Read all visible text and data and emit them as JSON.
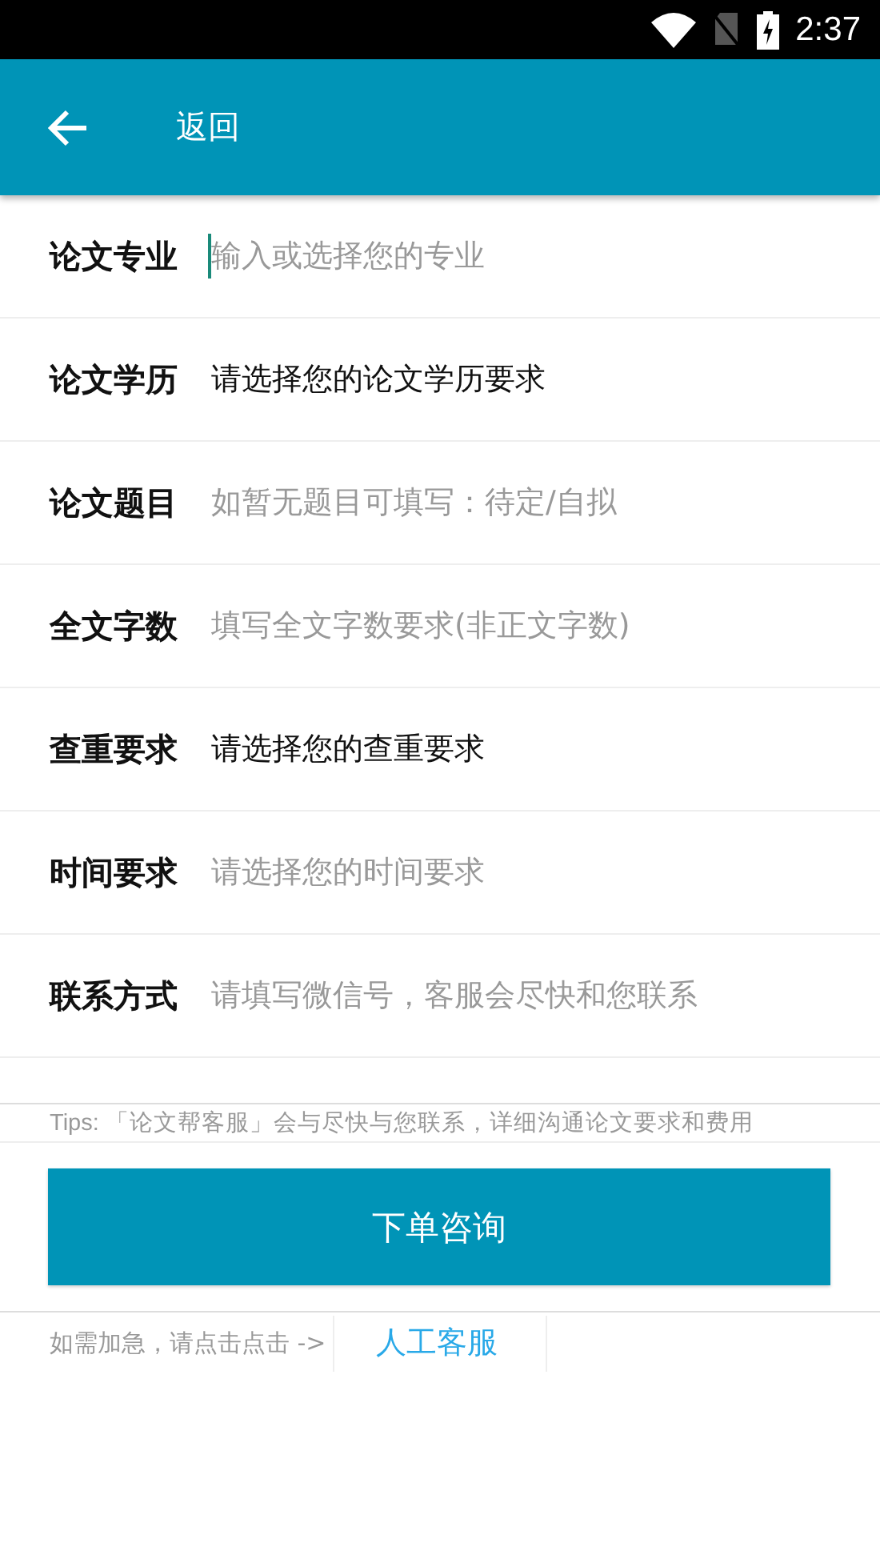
{
  "status_bar": {
    "time": "2:37"
  },
  "app_bar": {
    "back_label": "返回"
  },
  "fields": [
    {
      "label": "论文专业",
      "kind": "input",
      "placeholder": "输入或选择您的专业",
      "focused": true
    },
    {
      "label": "论文学历",
      "kind": "select",
      "value": "请选择您的论文学历要求",
      "focused": false
    },
    {
      "label": "论文题目",
      "kind": "input",
      "placeholder": "如暂无题目可填写：待定/自拟",
      "focused": false
    },
    {
      "label": "全文字数",
      "kind": "input",
      "placeholder": "填写全文字数要求(非正文字数)",
      "focused": false
    },
    {
      "label": "查重要求",
      "kind": "select",
      "value": "请选择您的查重要求",
      "focused": false
    },
    {
      "label": "时间要求",
      "kind": "input",
      "placeholder": "请选择您的时间要求",
      "focused": false
    },
    {
      "label": "联系方式",
      "kind": "input",
      "placeholder": "请填写微信号，客服会尽快和您联系",
      "focused": false
    }
  ],
  "tips": "Tips: 「论文帮客服」会与尽快与您联系，详细沟通论文要求和费用",
  "submit_button": "下单咨询",
  "urgent": {
    "text": "如需加急，请点击点击 ->",
    "link": "人工客服"
  }
}
